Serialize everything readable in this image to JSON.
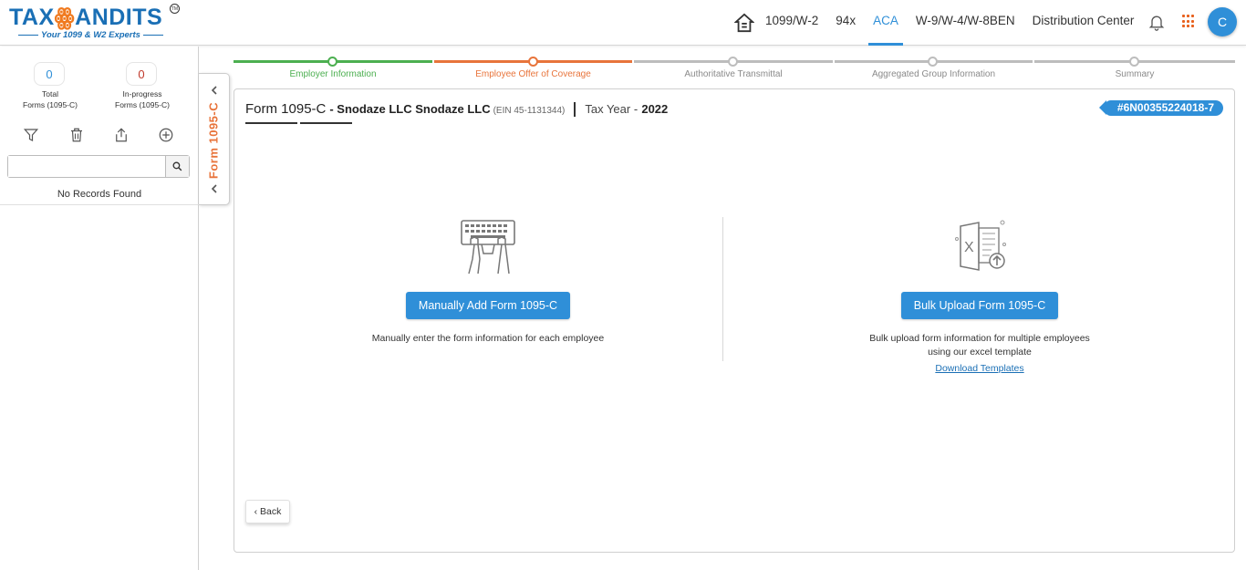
{
  "logo": {
    "brand_prefix": "TAX",
    "brand_suffix": "ANDITS",
    "tm": "TM",
    "tagline": "Your 1099 & W2 Experts"
  },
  "nav": {
    "items": [
      {
        "label": "1099/W-2",
        "active": false
      },
      {
        "label": "94x",
        "active": false
      },
      {
        "label": "ACA",
        "active": true
      },
      {
        "label": "W-9/W-4/W-8BEN",
        "active": false
      },
      {
        "label": "Distribution Center",
        "active": false
      }
    ],
    "icons": {
      "home": "home-icon",
      "bell": "bell-icon",
      "apps": "apps-grid-icon"
    },
    "avatar_initial": "C",
    "accent_color": "#2f8fd8"
  },
  "sidebar": {
    "total_count": "0",
    "total_label_1": "Total",
    "total_label_2": "Forms (1095-C)",
    "progress_count": "0",
    "progress_label_1": "In-progress",
    "progress_label_2": "Forms (1095-C)",
    "search_placeholder": "",
    "no_records": "No Records Found",
    "tab_label": "Form 1095-C"
  },
  "stepper": {
    "steps": [
      {
        "label": "Employer Information",
        "status": "done"
      },
      {
        "label": "Employee Offer of Coverage",
        "status": "current"
      },
      {
        "label": "Authoritative Transmittal",
        "status": "pending"
      },
      {
        "label": "Aggregated Group Information",
        "status": "pending"
      },
      {
        "label": "Summary",
        "status": "pending"
      }
    ],
    "colors": {
      "done": "#4caf50",
      "current": "#e8743b",
      "pending": "#bdbdbd"
    }
  },
  "card": {
    "form_name": "Form 1095-C",
    "company": "- Snodaze LLC Snodaze LLC",
    "ein": "(EIN 45-1131344)",
    "tax_year_label": "Tax Year -",
    "tax_year": "2022",
    "submission_id": "#6N00355224018-7",
    "manual": {
      "button": "Manually Add Form 1095-C",
      "description": "Manually enter the form information for each employee"
    },
    "bulk": {
      "button": "Bulk Upload Form 1095-C",
      "description_1": "Bulk upload form information for multiple employees",
      "description_2": "using our excel template",
      "link": "Download Templates"
    },
    "back_label": "Back"
  }
}
